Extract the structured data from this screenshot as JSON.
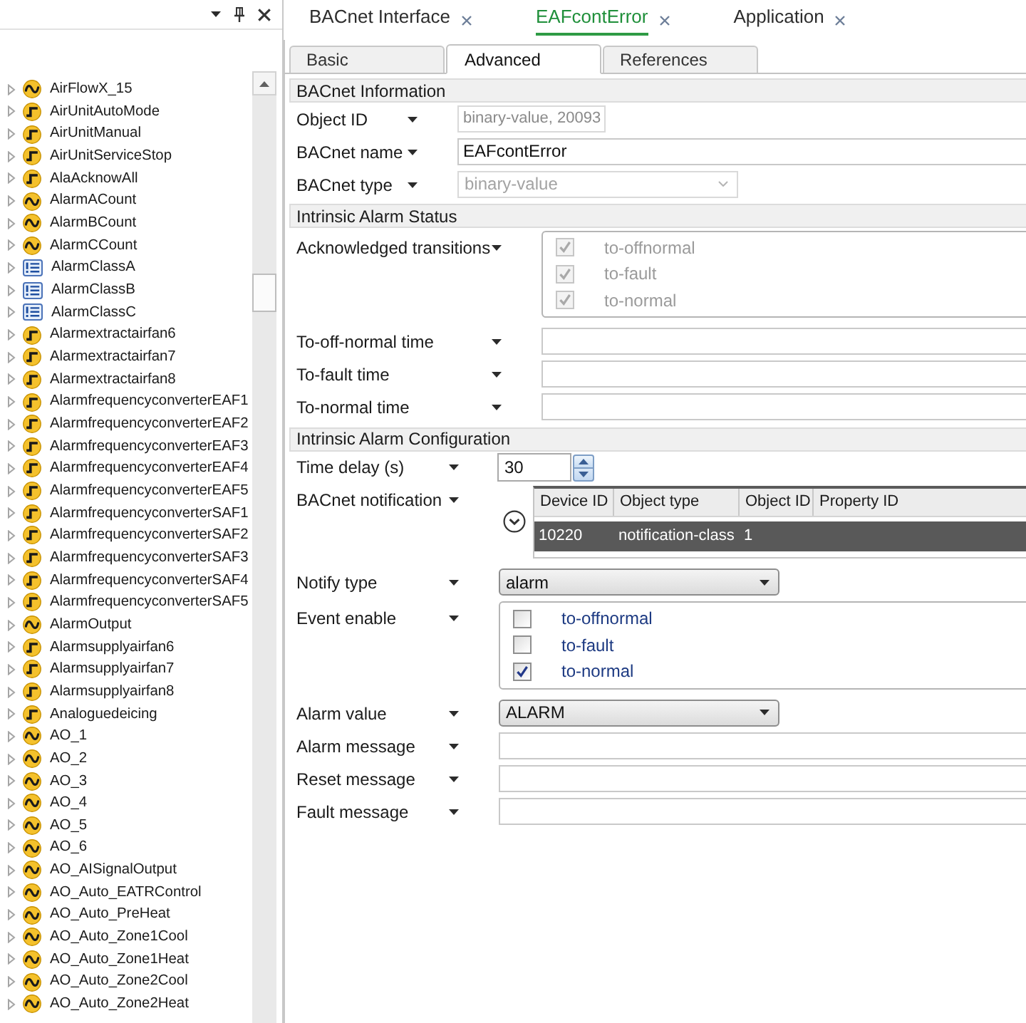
{
  "side_panel": {
    "items": [
      {
        "label": "AirFlowX_15",
        "kind": "analog",
        "expanded": false
      },
      {
        "label": "AirUnitAutoMode",
        "kind": "binary",
        "expanded": false
      },
      {
        "label": "AirUnitManual",
        "kind": "binary",
        "expanded": false
      },
      {
        "label": "AirUnitServiceStop",
        "kind": "binary",
        "expanded": false
      },
      {
        "label": "AlaAcknowAll",
        "kind": "binary",
        "expanded": false
      },
      {
        "label": "AlarmACount",
        "kind": "analog",
        "expanded": false
      },
      {
        "label": "AlarmBCount",
        "kind": "analog",
        "expanded": false
      },
      {
        "label": "AlarmCCount",
        "kind": "analog",
        "expanded": false
      },
      {
        "label": "AlarmClassA",
        "kind": "multistate",
        "expanded": false
      },
      {
        "label": "AlarmClassB",
        "kind": "multistate",
        "expanded": false
      },
      {
        "label": "AlarmClassC",
        "kind": "multistate",
        "expanded": false
      },
      {
        "label": "Alarmextractairfan6",
        "kind": "binary",
        "expanded": false
      },
      {
        "label": "Alarmextractairfan7",
        "kind": "binary",
        "expanded": false
      },
      {
        "label": "Alarmextractairfan8",
        "kind": "binary",
        "expanded": false
      },
      {
        "label": "AlarmfrequencyconverterEAF1",
        "kind": "binary",
        "expanded": false
      },
      {
        "label": "AlarmfrequencyconverterEAF2",
        "kind": "binary",
        "expanded": false
      },
      {
        "label": "AlarmfrequencyconverterEAF3",
        "kind": "binary",
        "expanded": false
      },
      {
        "label": "AlarmfrequencyconverterEAF4",
        "kind": "binary",
        "expanded": false
      },
      {
        "label": "AlarmfrequencyconverterEAF5",
        "kind": "binary",
        "expanded": false
      },
      {
        "label": "AlarmfrequencyconverterSAF1",
        "kind": "binary",
        "expanded": false
      },
      {
        "label": "AlarmfrequencyconverterSAF2",
        "kind": "binary",
        "expanded": false
      },
      {
        "label": "AlarmfrequencyconverterSAF3",
        "kind": "binary",
        "expanded": false
      },
      {
        "label": "AlarmfrequencyconverterSAF4",
        "kind": "binary",
        "expanded": false
      },
      {
        "label": "AlarmfrequencyconverterSAF5",
        "kind": "binary",
        "expanded": false
      },
      {
        "label": "AlarmOutput",
        "kind": "analog",
        "expanded": false
      },
      {
        "label": "Alarmsupplyairfan6",
        "kind": "binary",
        "expanded": false
      },
      {
        "label": "Alarmsupplyairfan7",
        "kind": "binary",
        "expanded": false
      },
      {
        "label": "Alarmsupplyairfan8",
        "kind": "binary",
        "expanded": false
      },
      {
        "label": "Analoguedeicing",
        "kind": "binary",
        "expanded": false
      },
      {
        "label": "AO_1",
        "kind": "analog",
        "expanded": false
      },
      {
        "label": "AO_2",
        "kind": "analog",
        "expanded": false
      },
      {
        "label": "AO_3",
        "kind": "analog",
        "expanded": false
      },
      {
        "label": "AO_4",
        "kind": "analog",
        "expanded": false
      },
      {
        "label": "AO_5",
        "kind": "analog",
        "expanded": false
      },
      {
        "label": "AO_6",
        "kind": "analog",
        "expanded": false
      },
      {
        "label": "AO_AISignalOutput",
        "kind": "analog",
        "expanded": false
      },
      {
        "label": "AO_Auto_EATRControl",
        "kind": "analog",
        "expanded": false
      },
      {
        "label": "AO_Auto_PreHeat",
        "kind": "analog",
        "expanded": false
      },
      {
        "label": "AO_Auto_Zone1Cool",
        "kind": "analog",
        "expanded": false
      },
      {
        "label": "AO_Auto_Zone1Heat",
        "kind": "analog",
        "expanded": false
      },
      {
        "label": "AO_Auto_Zone2Cool",
        "kind": "analog",
        "expanded": false
      },
      {
        "label": "AO_Auto_Zone2Heat",
        "kind": "analog",
        "expanded": false
      }
    ]
  },
  "document_tabs": [
    {
      "label": "BACnet Interface",
      "selected": false
    },
    {
      "label": "EAFcontError",
      "selected": true
    },
    {
      "label": "Application",
      "selected": false
    }
  ],
  "property_tabs": [
    {
      "label": "Basic",
      "selected": false
    },
    {
      "label": "Advanced",
      "selected": true
    },
    {
      "label": "References",
      "selected": false
    }
  ],
  "sections": [
    {
      "title": "BACnet Information",
      "rows": [
        {
          "label": "Object ID",
          "kind": "readonly",
          "value": "binary-value, 20093"
        },
        {
          "label": "BACnet name",
          "kind": "text",
          "value": "EAFcontError"
        },
        {
          "label": "BACnet type",
          "kind": "select",
          "value": "binary-value",
          "disabled": true
        }
      ]
    },
    {
      "title": "Intrinsic Alarm Status",
      "rows": [
        {
          "label": "Acknowledged transitions",
          "kind": "checks",
          "disabled": true,
          "options": [
            {
              "label": "to-offnormal",
              "checked": true
            },
            {
              "label": "to-fault",
              "checked": true
            },
            {
              "label": "to-normal",
              "checked": true
            }
          ]
        },
        {
          "label": "To-off-normal time",
          "kind": "text"
        },
        {
          "label": "To-fault time",
          "kind": "text"
        },
        {
          "label": "To-normal time",
          "kind": "text"
        }
      ]
    },
    {
      "title": "Intrinsic Alarm Configuration",
      "rows": [
        {
          "label": "Time delay (s)",
          "kind": "spin",
          "value": "30"
        },
        {
          "label": "BACnet notification",
          "kind": "table",
          "columns": [
            "Device ID",
            "Object type",
            "Object ID",
            "Property ID"
          ],
          "rows": [
            {
              "cells": [
                "10220",
                "notification-class",
                "1"
              ],
              "selected": true
            }
          ]
        },
        {
          "label": "Notify type",
          "kind": "select",
          "value": "alarm",
          "disabled": false
        },
        {
          "label": "Event enable",
          "kind": "checks",
          "disabled": false,
          "options": [
            {
              "label": "to-offnormal",
              "checked": false
            },
            {
              "label": "to-fault",
              "checked": false
            },
            {
              "label": "to-normal",
              "checked": true
            }
          ]
        },
        {
          "label": "Alarm value",
          "kind": "select",
          "value": "ALARM",
          "disabled": false
        },
        {
          "label": "Alarm message",
          "kind": "text"
        },
        {
          "label": "Reset message",
          "kind": "text"
        },
        {
          "label": "Fault message",
          "kind": "text"
        }
      ]
    }
  ]
}
